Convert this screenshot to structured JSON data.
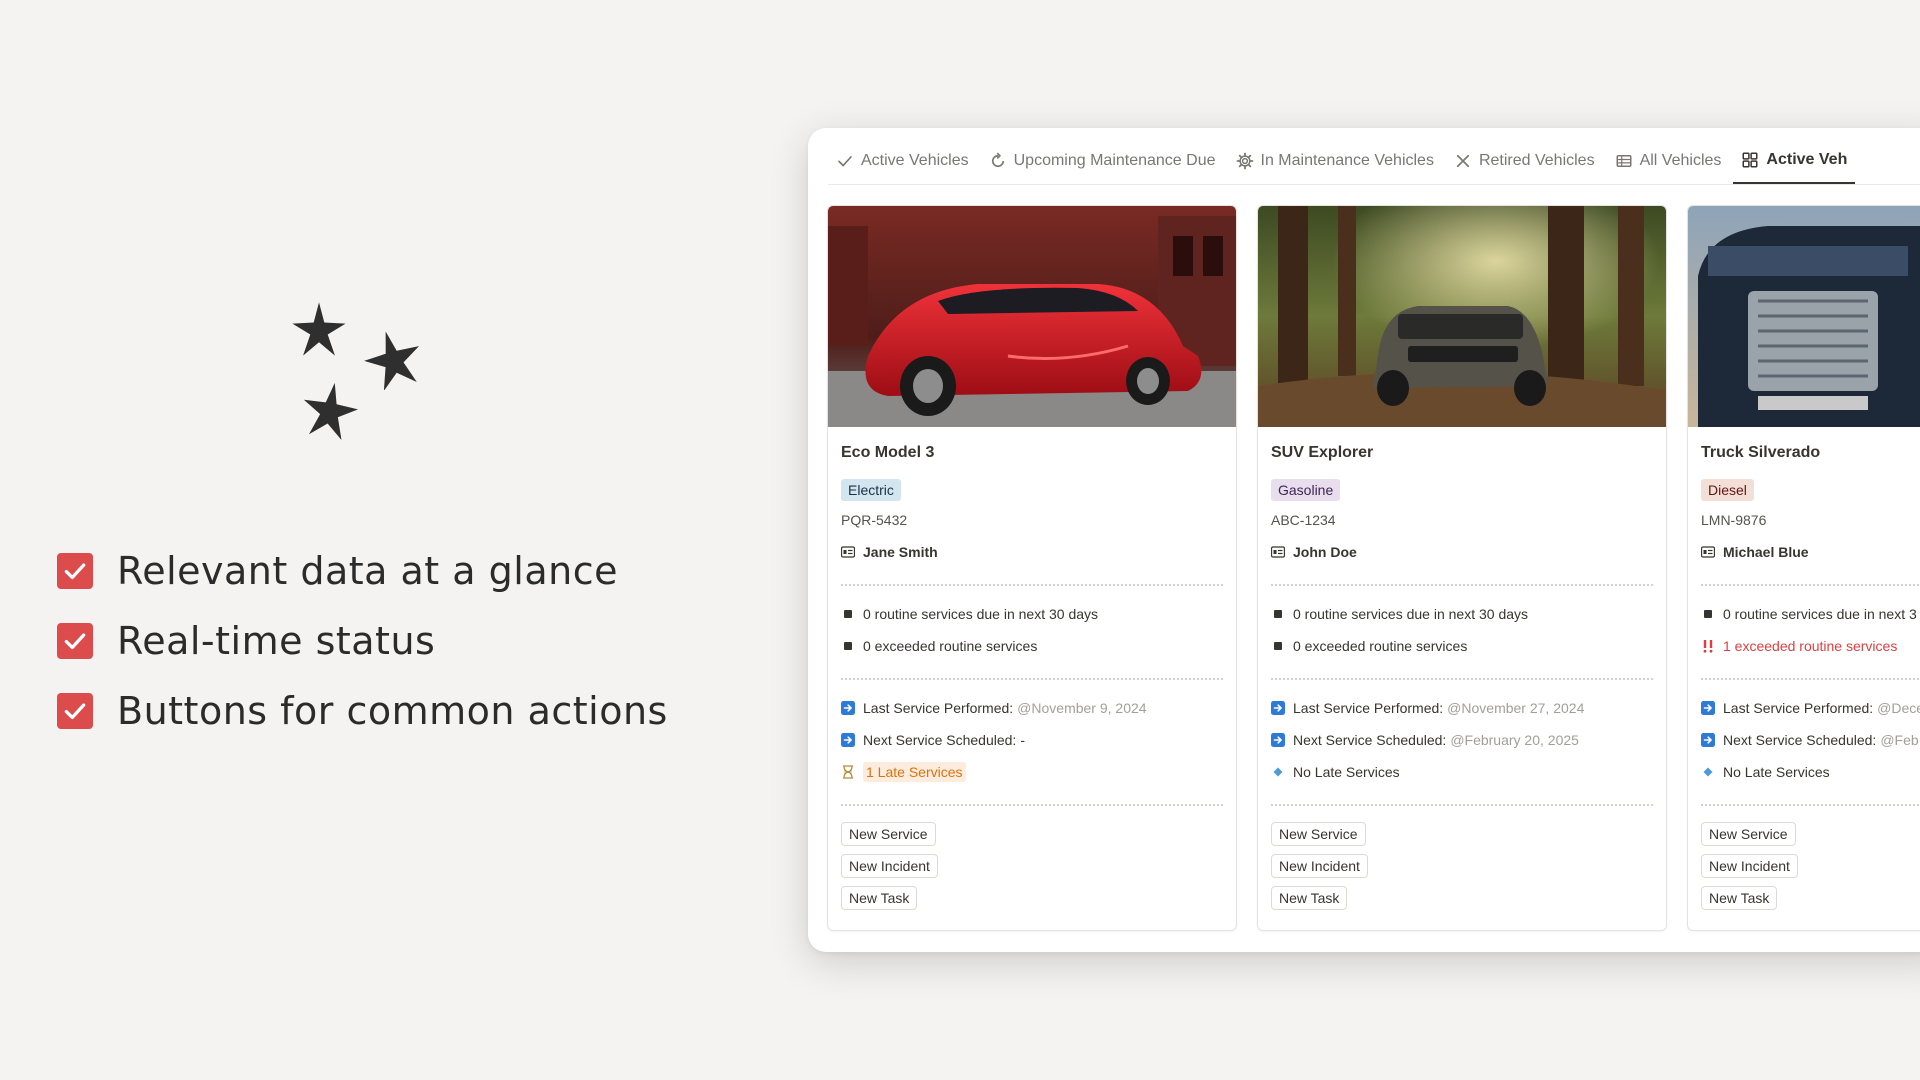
{
  "features": [
    {
      "label": "Relevant data at a glance"
    },
    {
      "label": "Real-time status"
    },
    {
      "label": "Buttons for common actions"
    }
  ],
  "tabs": [
    {
      "label": "Active Vehicles",
      "icon": "check-icon"
    },
    {
      "label": "Upcoming Maintenance Due",
      "icon": "refresh-icon"
    },
    {
      "label": "In Maintenance Vehicles",
      "icon": "gear-icon"
    },
    {
      "label": "Retired Vehicles",
      "icon": "x-icon"
    },
    {
      "label": "All Vehicles",
      "icon": "table-icon"
    },
    {
      "label": "Active Veh",
      "icon": "gallery-icon",
      "active": true
    }
  ],
  "cards": [
    {
      "title": "Eco Model 3",
      "fuel": {
        "label": "Electric",
        "bg": "#d3e5ef",
        "fg": "#183347"
      },
      "plate": "PQR-5432",
      "owner": "Jane Smith",
      "routine_due": "0 routine services due in next 30 days",
      "exceeded": "0 exceeded routine services",
      "exceeded_alert": false,
      "last_service_label": "Last Service Performed:",
      "last_service_value": "@November 9, 2024",
      "next_service_label": "Next Service Scheduled:",
      "next_service_value": "-",
      "late": "1 Late Services",
      "late_alert": true,
      "buttons": [
        "New Service",
        "New Incident",
        "New Task"
      ]
    },
    {
      "title": "SUV Explorer",
      "fuel": {
        "label": "Gasoline",
        "bg": "#e8deee",
        "fg": "#412454"
      },
      "plate": "ABC-1234",
      "owner": "John Doe",
      "routine_due": "0 routine services due in next 30 days",
      "exceeded": "0 exceeded routine services",
      "exceeded_alert": false,
      "last_service_label": "Last Service Performed:",
      "last_service_value": "@November 27, 2024",
      "next_service_label": "Next Service Scheduled:",
      "next_service_value": "@February 20, 2025",
      "late": "No Late Services",
      "late_alert": false,
      "buttons": [
        "New Service",
        "New Incident",
        "New Task"
      ]
    },
    {
      "title": "Truck Silverado",
      "fuel": {
        "label": "Diesel",
        "bg": "#f4dfd6",
        "fg": "#5d1715"
      },
      "plate": "LMN-9876",
      "owner": "Michael Blue",
      "routine_due": "0 routine services due in next 3",
      "exceeded": "1 exceeded routine services",
      "exceeded_alert": true,
      "last_service_label": "Last Service Performed:",
      "last_service_value": "@Dece",
      "next_service_label": "Next Service Scheduled:",
      "next_service_value": "@Feb",
      "late": "No Late Services",
      "late_alert": false,
      "buttons": [
        "New Service",
        "New Incident",
        "New Task"
      ]
    }
  ],
  "colors": {
    "background": "#f4f3f1",
    "checkbox": "#dc4c4c",
    "card_border": "#e4e3e0",
    "link_blue": "#2e7bd6"
  }
}
